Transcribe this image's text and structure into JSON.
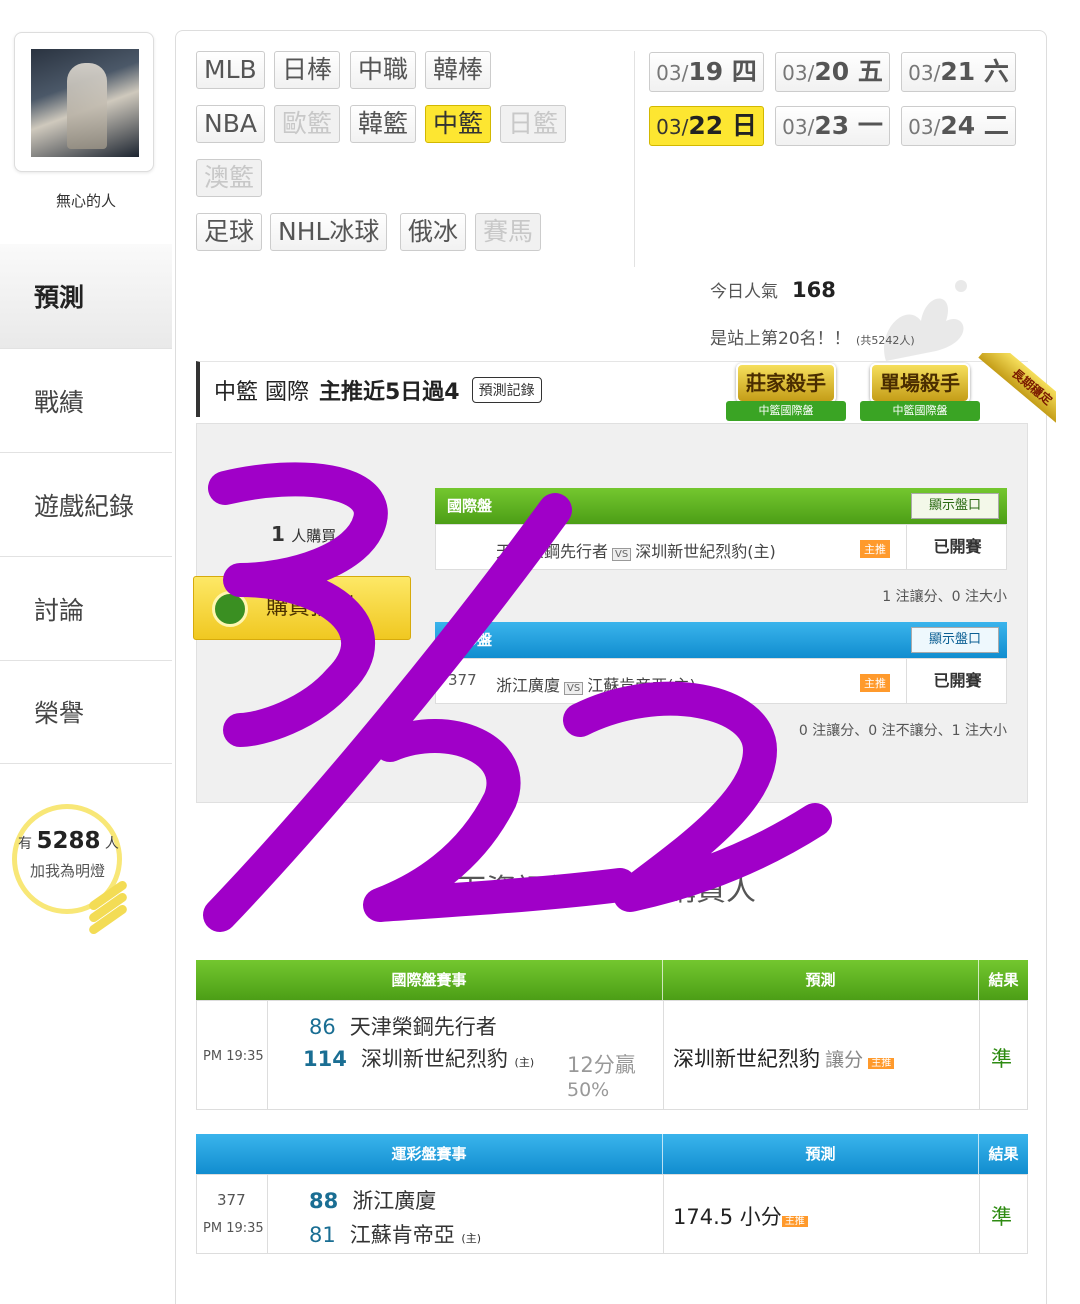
{
  "sidebar": {
    "username": "無心的人",
    "nav": [
      {
        "label": "預測",
        "active": true
      },
      {
        "label": "戰績",
        "active": false
      },
      {
        "label": "遊戲紀錄",
        "active": false
      },
      {
        "label": "討論",
        "active": false
      },
      {
        "label": "榮譽",
        "active": false
      }
    ],
    "fans_prefix": "有",
    "fans_count": "5288",
    "fans_suffix": "人",
    "fans_label": "加我為明燈"
  },
  "sports": [
    {
      "label": "MLB",
      "state": "normal"
    },
    {
      "label": "日棒",
      "state": "normal"
    },
    {
      "label": "中職",
      "state": "normal"
    },
    {
      "label": "韓棒",
      "state": "normal"
    },
    {
      "label": "NBA",
      "state": "normal"
    },
    {
      "label": "歐籃",
      "state": "disabled"
    },
    {
      "label": "韓籃",
      "state": "normal"
    },
    {
      "label": "中籃",
      "state": "active"
    },
    {
      "label": "日籃",
      "state": "disabled"
    },
    {
      "label": "澳籃",
      "state": "disabled"
    },
    {
      "label": "足球",
      "state": "normal"
    },
    {
      "label": "NHL冰球",
      "state": "normal"
    },
    {
      "label": "俄冰",
      "state": "normal"
    },
    {
      "label": "賽馬",
      "state": "disabled"
    }
  ],
  "dates": [
    {
      "month": "03/",
      "day": "19 四",
      "active": false
    },
    {
      "month": "03/",
      "day": "20 五",
      "active": false
    },
    {
      "month": "03/",
      "day": "21 六",
      "active": false
    },
    {
      "month": "03/",
      "day": "22 日",
      "active": true
    },
    {
      "month": "03/",
      "day": "23 一",
      "active": false
    },
    {
      "month": "03/",
      "day": "24 二",
      "active": false
    }
  ],
  "popularity": {
    "label": "今日人氣",
    "value": "168",
    "rank_text": "是站上第20名！！",
    "rank_total": "(共5242人)"
  },
  "header": {
    "league": "中籃 國際",
    "highlight": "主推近5日過4",
    "record_button": "預測記錄"
  },
  "badges": [
    {
      "title": "莊家殺手",
      "sub": "中籃國際盤"
    },
    {
      "title": "單場殺手",
      "sub": "中籃國際盤"
    }
  ],
  "corner_ribbon": "長期穩定",
  "purchase": {
    "count": "1",
    "count_label": "人購買",
    "button": "購買預測"
  },
  "intl_table": {
    "title": "國際盤",
    "show_button": "顯示盤口",
    "away": "天津榮鋼先行者",
    "vs": "VS",
    "home": "深圳新世紀烈豹(主)",
    "tag": "主推",
    "result": "已開賽",
    "note": "1 注讓分、0 注大小"
  },
  "sport_table": {
    "title": "運彩盤",
    "show_button": "顯示盤口",
    "game_no": "377",
    "away": "浙江廣廈",
    "vs": "VS",
    "home": "江蘇肯帝亞(主)",
    "tag": "主推",
    "result": "已開賽",
    "note": "0 注讓分、0 注不讓分、1 注大小"
  },
  "provide_text": "以下資訊僅提供給購買人",
  "results": {
    "intl": {
      "head_event": "國際盤賽事",
      "head_pred": "預測",
      "head_result": "結果",
      "time": "PM 19:35",
      "away_score": "86",
      "away_team": "天津榮鋼先行者",
      "home_score": "114",
      "home_team": "深圳新世紀烈豹",
      "home_mark": "(主)",
      "margin": "12分贏",
      "pct": "50%",
      "prediction": "深圳新世紀烈豹",
      "pred_type": "讓分",
      "tag": "主推",
      "outcome": "準"
    },
    "sport": {
      "head_event": "運彩盤賽事",
      "head_pred": "預測",
      "head_result": "結果",
      "game_no": "377",
      "time": "PM 19:35",
      "away_score": "88",
      "away_team": "浙江廣廈",
      "home_score": "81",
      "home_team": "江蘇肯帝亞",
      "home_mark": "(主)",
      "prediction": "174.5 小分",
      "tag": "主推",
      "outcome": "準"
    }
  },
  "handwriting": "3/22",
  "colors": {
    "active_yellow": "#fde631",
    "green_header": "#5aaf1f",
    "blue_header": "#1a9bdc",
    "scribble": "#a000c8",
    "win_green": "#2e8b12"
  }
}
